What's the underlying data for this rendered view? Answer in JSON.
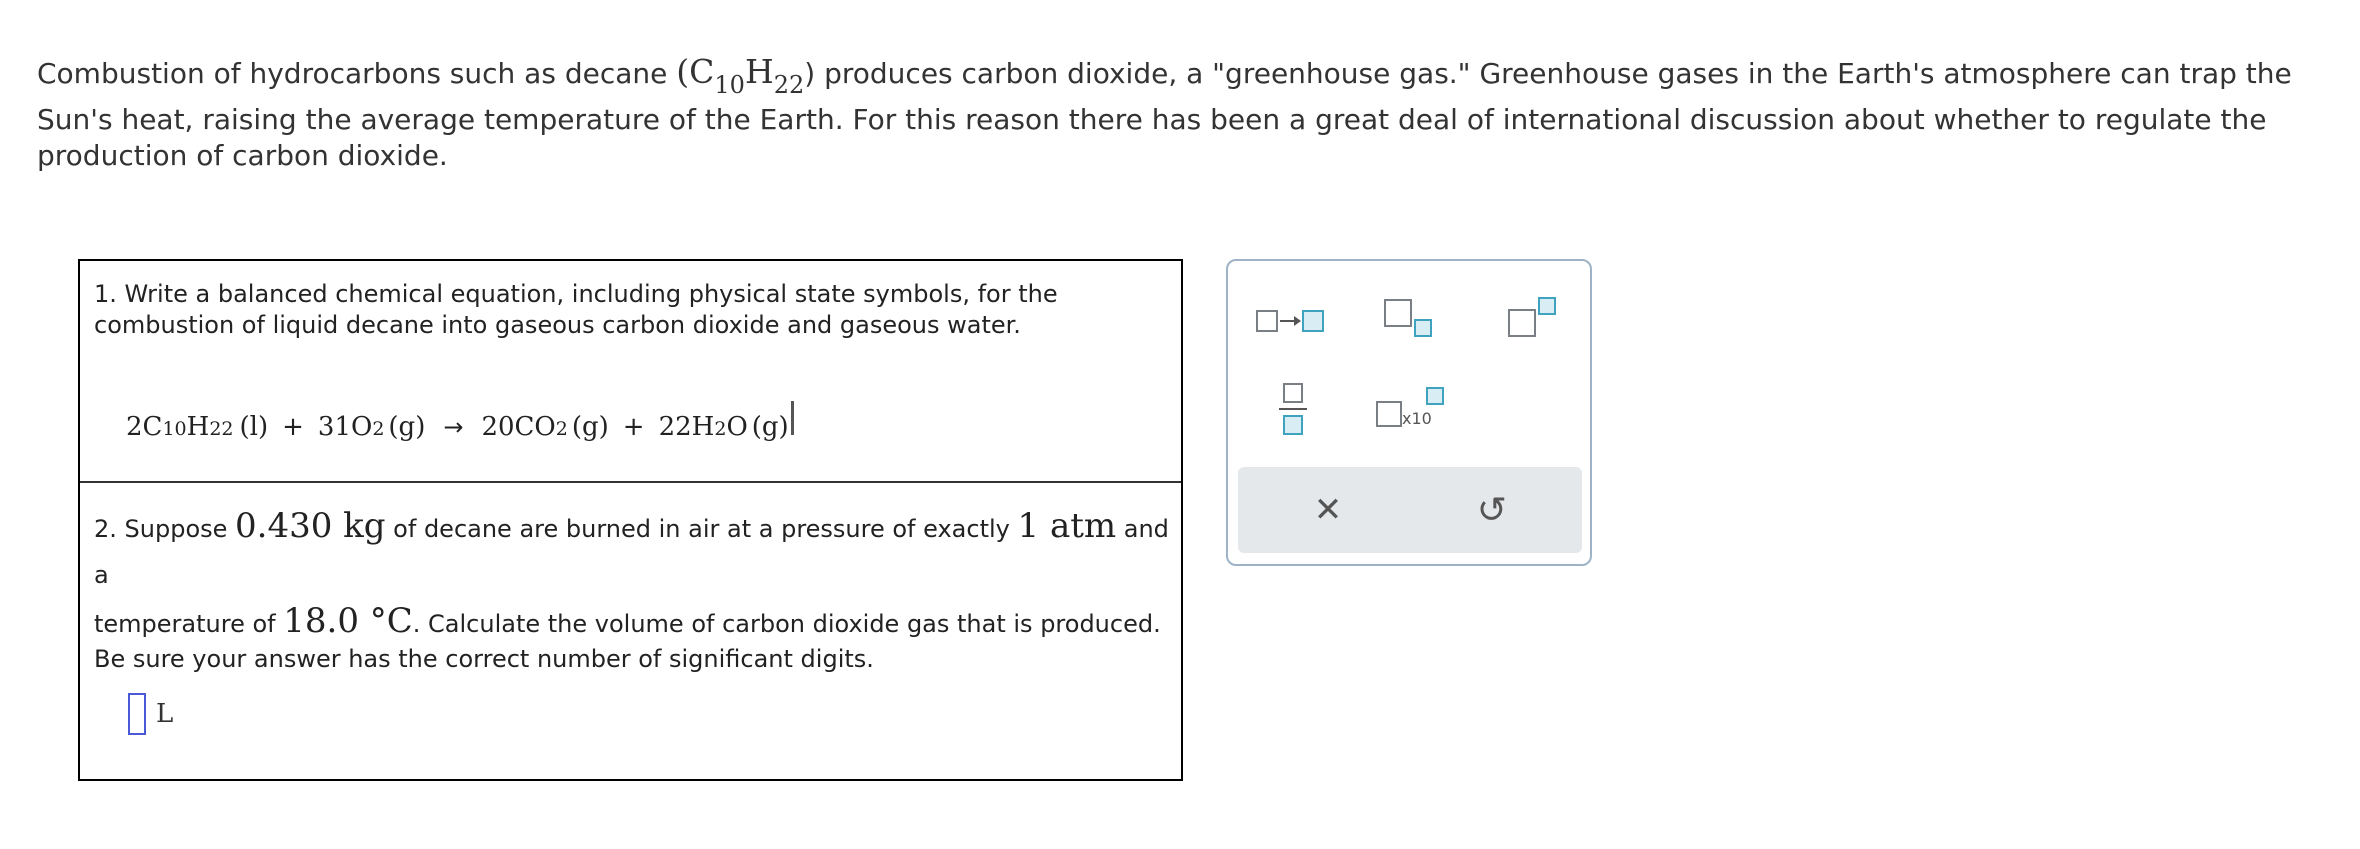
{
  "intro": {
    "before_formula": "Combustion of hydrocarbons such as decane ",
    "formula_open": "(C",
    "formula_sub1": "10",
    "formula_h": "H",
    "formula_sub2": "22",
    "formula_close": ")",
    "after_formula": " produces carbon dioxide, a \"greenhouse gas.\" Greenhouse gases in the Earth's atmosphere can trap the",
    "rest": "Sun's heat, raising the average temperature of the Earth. For this reason there has been a great deal of international discussion about whether to regulate the production of carbon dioxide."
  },
  "question1": {
    "text": "1. Write a balanced chemical equation, including physical state symbols, for the combustion of liquid decane into gaseous carbon dioxide and gaseous water.",
    "equation": {
      "r1_coef": "2C",
      "r1_sub1": "10",
      "r1_h": "H",
      "r1_sub2": "22",
      "r1_state": "(l)",
      "plus": "+",
      "r2_coef": "31O",
      "r2_sub": "2",
      "r2_state": "(g)",
      "arrow": "→",
      "p1_coef": "20CO",
      "p1_sub": "2",
      "p1_state": "(g)",
      "p2_coef": "22H",
      "p2_sub": "2",
      "p2_o": "O",
      "p2_state": "(g)"
    }
  },
  "question2": {
    "t1": "2. Suppose ",
    "mass": "0.430 kg",
    "t2": " of decane are burned in air at a pressure of exactly ",
    "pressure": "1 atm",
    "t3": " and a",
    "t4": "temperature of ",
    "temperature": "18.0 °C",
    "t5": ". Calculate the volume of carbon dioxide gas that is produced.",
    "t6": "Be sure your answer has the correct number of significant digits.",
    "answer_value": "",
    "answer_unit": "L"
  },
  "toolbox": {
    "tools": [
      "arrow-template-icon",
      "subscript-icon",
      "superscript-icon",
      "fraction-icon",
      "scientific-notation-icon"
    ],
    "sci_label": "x10",
    "clear_symbol": "✕",
    "undo_symbol": "↺",
    "accent_color": "#3fa2bf"
  }
}
